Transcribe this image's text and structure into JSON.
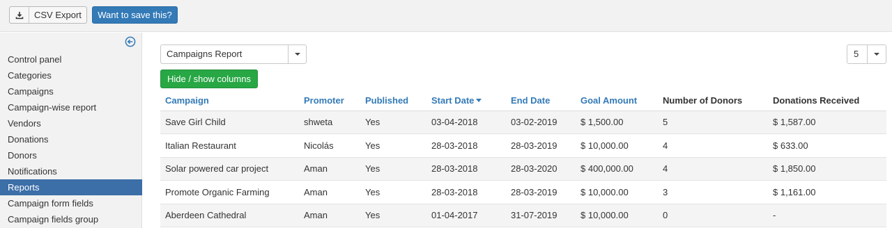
{
  "toolbar": {
    "export_label": "CSV Export",
    "save_label": "Want to save this?",
    "export_icon": "download-icon"
  },
  "sidebar": {
    "collapse_icon": "arrow-circle-left-icon",
    "items": [
      {
        "label": "Control panel"
      },
      {
        "label": "Categories"
      },
      {
        "label": "Campaigns"
      },
      {
        "label": "Campaign-wise report"
      },
      {
        "label": "Vendors"
      },
      {
        "label": "Donations"
      },
      {
        "label": "Donors"
      },
      {
        "label": "Notifications"
      },
      {
        "label": "Reports",
        "active": true
      },
      {
        "label": "Campaign form fields"
      },
      {
        "label": "Campaign fields group"
      }
    ]
  },
  "report_select": {
    "value": "Campaigns Report"
  },
  "page_size": {
    "value": "5"
  },
  "hide_show_label": "Hide / show columns",
  "table": {
    "columns": [
      "Campaign",
      "Promoter",
      "Published",
      "Start Date",
      "End Date",
      "Goal Amount",
      "Number of Donors",
      "Donations Received"
    ],
    "sorted_column": "Start Date",
    "rows": [
      [
        "Save Girl Child",
        "shweta",
        "Yes",
        "03-04-2018",
        "03-02-2019",
        "$ 1,500.00",
        "5",
        "$ 1,587.00"
      ],
      [
        "Italian Restaurant",
        "Nicolás",
        "Yes",
        "28-03-2018",
        "28-03-2019",
        "$ 10,000.00",
        "4",
        "$ 633.00"
      ],
      [
        "Solar powered car project",
        "Aman",
        "Yes",
        "28-03-2018",
        "28-03-2020",
        "$ 400,000.00",
        "4",
        "$ 1,850.00"
      ],
      [
        "Promote Organic Farming",
        "Aman",
        "Yes",
        "28-03-2018",
        "28-03-2019",
        "$ 10,000.00",
        "3",
        "$ 1,161.00"
      ],
      [
        "Aberdeen Cathedral",
        "Aman",
        "Yes",
        "01-04-2017",
        "31-07-2019",
        "$ 10,000.00",
        "0",
        "-"
      ]
    ]
  },
  "colors": {
    "link": "#337ab7",
    "active_nav": "#3c6ea8",
    "save_button": "#337ab7",
    "hide_button": "#28a745"
  }
}
